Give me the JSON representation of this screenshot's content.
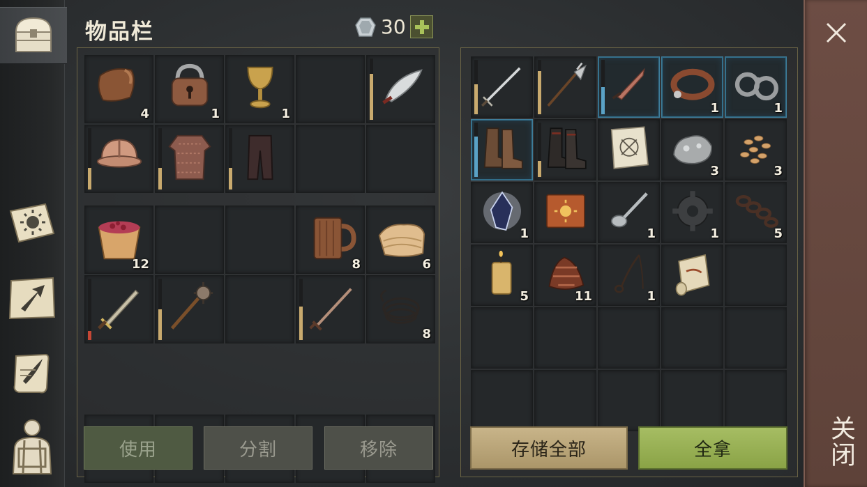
{
  "header": {
    "title": "物品栏",
    "gem_count": "30"
  },
  "sidebar": {
    "items": [
      {
        "name": "chest-icon",
        "active": true
      },
      {
        "name": "sun-book-icon",
        "active": false
      },
      {
        "name": "map-arrow-icon",
        "active": false
      },
      {
        "name": "scroll-quill-icon",
        "active": false
      },
      {
        "name": "backpack-character-icon",
        "active": false
      }
    ]
  },
  "left_inventory": [
    {
      "item": "leather-hide-icon",
      "count": "4"
    },
    {
      "item": "padlock-icon",
      "count": "1"
    },
    {
      "item": "golden-goblet-icon",
      "count": "1"
    },
    {
      "item": "",
      "count": ""
    },
    {
      "item": "scimitar-icon",
      "count": "",
      "durability": 0.75
    },
    {
      "item": "leather-helmet-icon",
      "count": "",
      "durability": 0.35
    },
    {
      "item": "chainmail-shirt-icon",
      "count": "",
      "durability": 0.35
    },
    {
      "item": "leather-pants-icon",
      "count": "",
      "durability": 0.35
    },
    {
      "item": "",
      "count": ""
    },
    {
      "item": "",
      "count": ""
    }
  ],
  "left_inventory_2": [
    {
      "item": "berry-bucket-icon",
      "count": "12"
    },
    {
      "item": "",
      "count": ""
    },
    {
      "item": "",
      "count": ""
    },
    {
      "item": "wooden-mug-icon",
      "count": "8"
    },
    {
      "item": "cloth-bundle-icon",
      "count": "6"
    },
    {
      "item": "short-sword-icon",
      "count": "",
      "durability": 0.15,
      "low": true
    },
    {
      "item": "spiked-mace-icon",
      "count": "",
      "durability": 0.5
    },
    {
      "item": "",
      "count": ""
    },
    {
      "item": "rapier-icon",
      "count": "",
      "durability": 0.55
    },
    {
      "item": "rope-coil-icon",
      "count": "8"
    }
  ],
  "right_inventory": [
    {
      "item": "longsword-icon",
      "count": "",
      "durability": 0.55
    },
    {
      "item": "halberd-icon",
      "count": "",
      "durability": 0.8
    },
    {
      "item": "dagger-icon",
      "count": "",
      "durability": 0.5,
      "blue": true,
      "framed": true
    },
    {
      "item": "leather-collar-icon",
      "count": "1",
      "framed": true
    },
    {
      "item": "iron-shackles-icon",
      "count": "1",
      "framed": true
    },
    {
      "item": "leather-boots-icon",
      "count": "",
      "durability": 0.75,
      "blue": true,
      "framed": true
    },
    {
      "item": "dark-boots-icon",
      "count": "",
      "durability": 0.3
    },
    {
      "item": "paper-map-icon",
      "count": ""
    },
    {
      "item": "iron-ore-icon",
      "count": "3"
    },
    {
      "item": "seeds-icon",
      "count": "3"
    },
    {
      "item": "magic-crystal-icon",
      "count": "1"
    },
    {
      "item": "sun-tome-icon",
      "count": ""
    },
    {
      "item": "spoon-icon",
      "count": "1"
    },
    {
      "item": "gear-part-icon",
      "count": "1"
    },
    {
      "item": "chain-icon",
      "count": "5"
    },
    {
      "item": "candle-icon",
      "count": "5"
    },
    {
      "item": "herb-bundle-icon",
      "count": "11"
    },
    {
      "item": "lasso-icon",
      "count": "1"
    },
    {
      "item": "parchment-roll-icon",
      "count": ""
    }
  ],
  "left_buttons": {
    "use": "使用",
    "split": "分割",
    "remove": "移除"
  },
  "right_buttons": {
    "store_all": "存储全部",
    "take_all": "全拿"
  },
  "close": {
    "label": "关闭"
  },
  "colors": {
    "accent_green": "#9db857",
    "accent_tan": "#c0ab7f",
    "close_panel": "#664840",
    "durability_bar": "#c9aa6e",
    "rare_blue": "#5aa2c6"
  }
}
